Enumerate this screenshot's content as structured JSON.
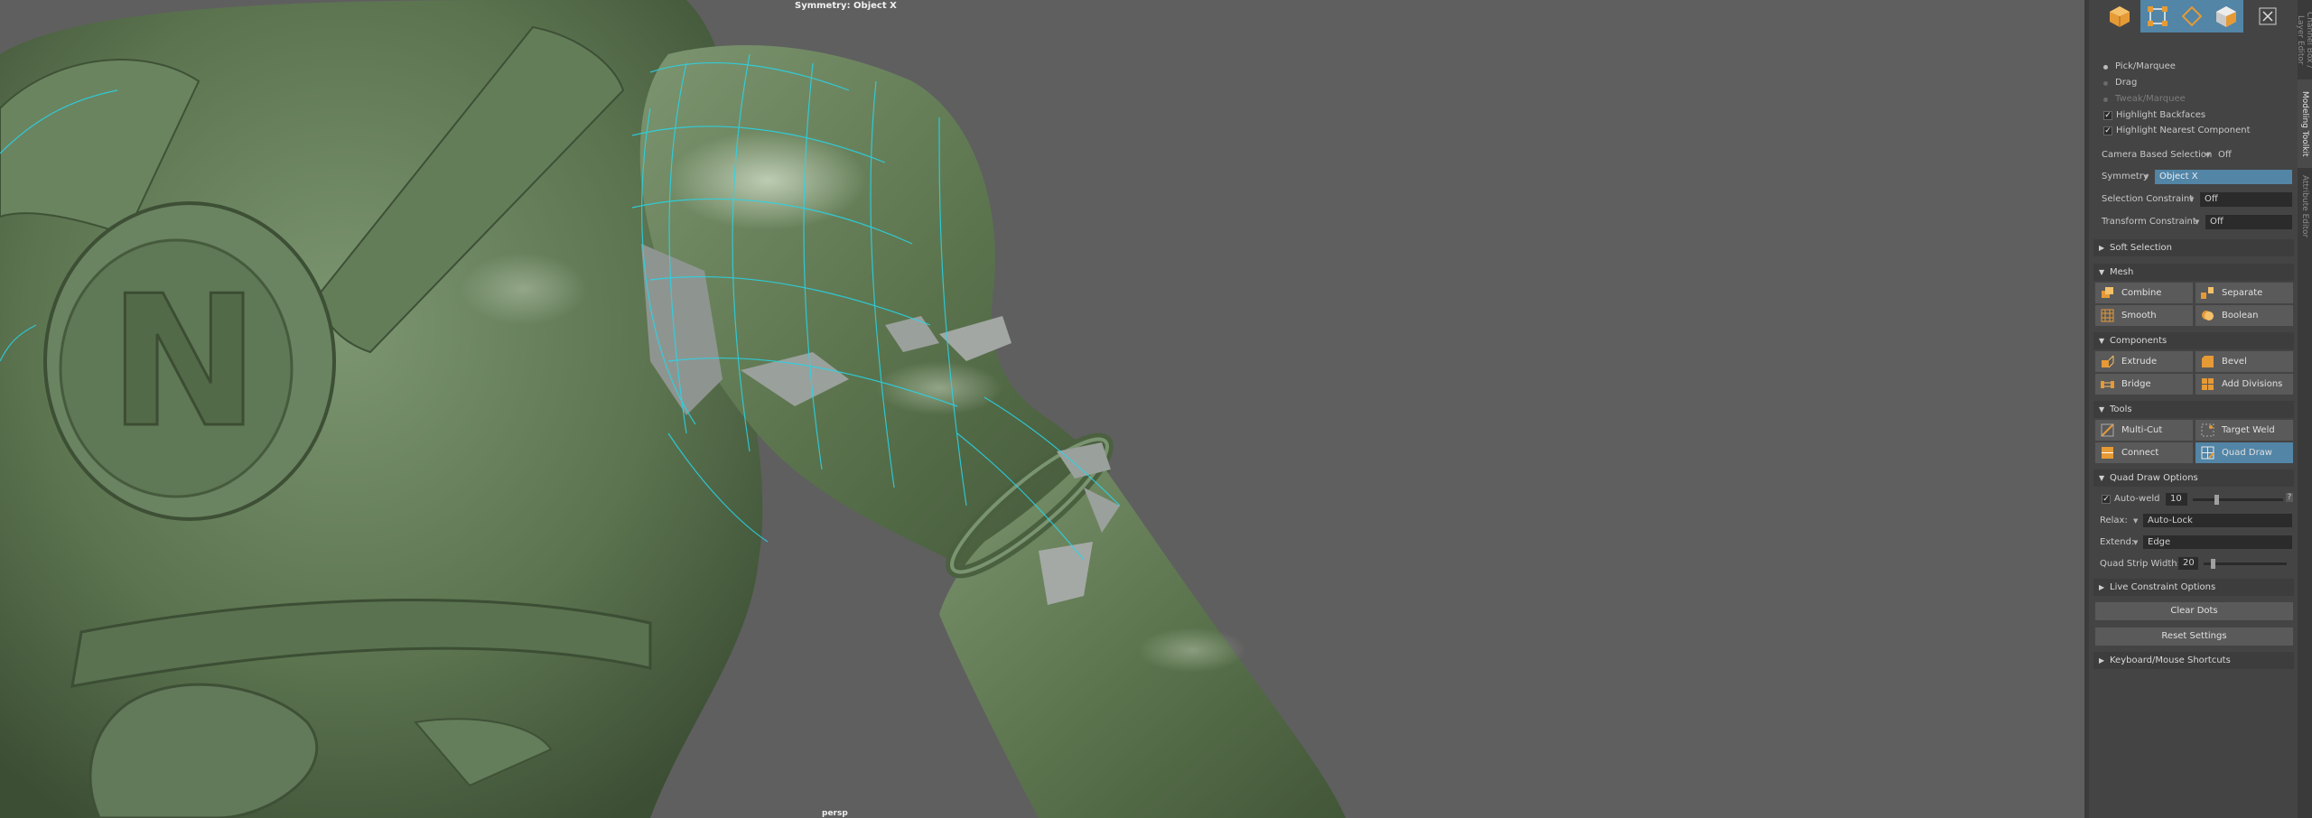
{
  "viewport": {
    "symmetry_hud": "Symmetry: Object X",
    "camera_label": "persp"
  },
  "top_icons": [
    {
      "name": "object-mode-icon",
      "selected": false
    },
    {
      "name": "multi-component-icon",
      "selected": true
    },
    {
      "name": "uv-mode-icon",
      "selected": true
    },
    {
      "name": "component-mode-icon",
      "selected": true
    },
    {
      "name": "close-toolkit-icon",
      "selected": false
    }
  ],
  "side_tabs": [
    "Channel Box / Layer Editor",
    "Modeling Toolkit",
    "Attribute Editor"
  ],
  "selection": {
    "pick_marquee": "Pick/Marquee",
    "drag": "Drag",
    "tweak_marquee": "Tweak/Marquee",
    "highlight_backfaces": "Highlight Backfaces",
    "highlight_nearest": "Highlight Nearest Component",
    "camera_based_label": "Camera Based Selection",
    "camera_based_value": "Off",
    "symmetry_label": "Symmetry",
    "symmetry_value": "Object X",
    "selection_constraint_label": "Selection Constraint",
    "selection_constraint_value": "Off",
    "transform_constraint_label": "Transform Constraint",
    "transform_constraint_value": "Off"
  },
  "sections": {
    "soft_selection": "Soft Selection",
    "mesh": "Mesh",
    "components": "Components",
    "tools": "Tools",
    "quad_draw_options": "Quad Draw Options",
    "live_constraint": "Live Constraint Options",
    "keyboard_shortcuts": "Keyboard/Mouse Shortcuts"
  },
  "mesh_buttons": [
    "Combine",
    "Separate",
    "Smooth",
    "Boolean"
  ],
  "component_buttons": [
    "Extrude",
    "Bevel",
    "Bridge",
    "Add Divisions"
  ],
  "tool_buttons": [
    "Multi-Cut",
    "Target Weld",
    "Connect",
    "Quad Draw"
  ],
  "quad_draw": {
    "auto_weld_label": "Auto-weld",
    "auto_weld_value": "10",
    "help": "?",
    "relax_label": "Relax:",
    "relax_value": "Auto-Lock",
    "extend_label": "Extend:",
    "extend_value": "Edge",
    "strip_width_label": "Quad Strip Width:",
    "strip_width_value": "20"
  },
  "buttons": {
    "clear_dots": "Clear Dots",
    "reset_settings": "Reset Settings"
  },
  "colors": {
    "accent": "#5285a6",
    "mesh": "#5c7550",
    "wire": "#27d6ea"
  }
}
